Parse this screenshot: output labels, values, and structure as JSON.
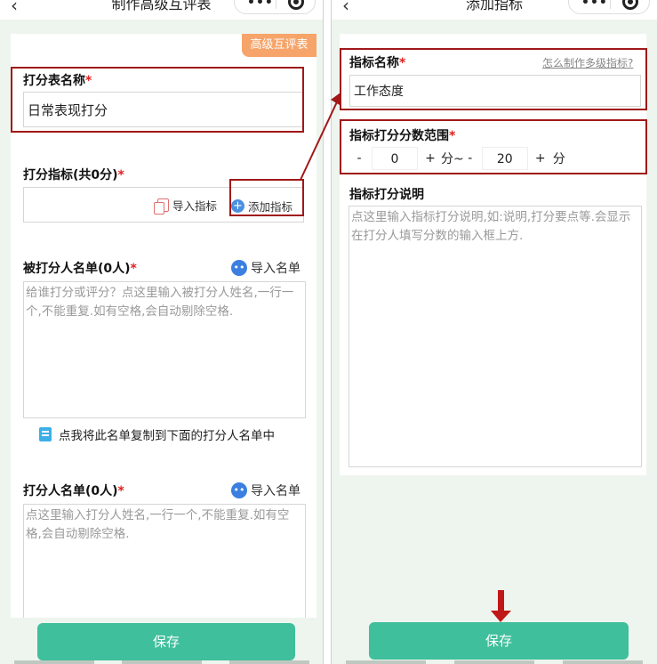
{
  "left": {
    "nav_title": "制作高级互评表",
    "badge": "高级互评表",
    "form_name": {
      "label": "打分表名称",
      "required": "*",
      "value": "日常表现打分"
    },
    "indicators": {
      "label": "打分指标(共0分)",
      "required": "*",
      "import_label": "导入指标",
      "add_label": "添加指标"
    },
    "scored_list": {
      "label": "被打分人名单(0人)",
      "required": "*",
      "import_label": "导入名单",
      "placeholder": "给谁打分或评分？点这里输入被打分人姓名,一行一个,不能重复.如有空格,会自动剔除空格."
    },
    "copy_tip": "点我将此名单复制到下面的打分人名单中",
    "scorer_list": {
      "label": "打分人名单(0人)",
      "required": "*",
      "import_label": "导入名单",
      "placeholder": "点这里输入打分人姓名,一行一个,不能重复.如有空格,会自动剔除空格."
    },
    "save_label": "保存"
  },
  "right": {
    "nav_title": "添加指标",
    "indicator_name": {
      "label": "指标名称",
      "required": "*",
      "help_link": "怎么制作多级指标?",
      "value": "工作态度"
    },
    "score_range": {
      "label": "指标打分分数范围",
      "required": "*",
      "minus": "-",
      "plus": "+",
      "min_value": "0",
      "max_value": "20",
      "unit_mid": "分~",
      "unit_end": "分"
    },
    "description": {
      "label": "指标打分说明",
      "placeholder": "点这里输入指标打分说明,如:说明,打分要点等.会显示在打分人填写分数的输入框上方."
    },
    "save_label": "保存"
  },
  "colors": {
    "accent": "#3fbf9c",
    "badge": "#f6a46a",
    "highlight": "#a01818",
    "required": "#e02020",
    "background": "#eef5ee"
  },
  "icons": {
    "back": "chevron-left-icon",
    "more": "more-dots-icon",
    "close": "target-circle-icon",
    "import": "documents-icon",
    "add": "plus-circle-icon",
    "import_list": "persons-icon",
    "copy": "copy-icon"
  }
}
